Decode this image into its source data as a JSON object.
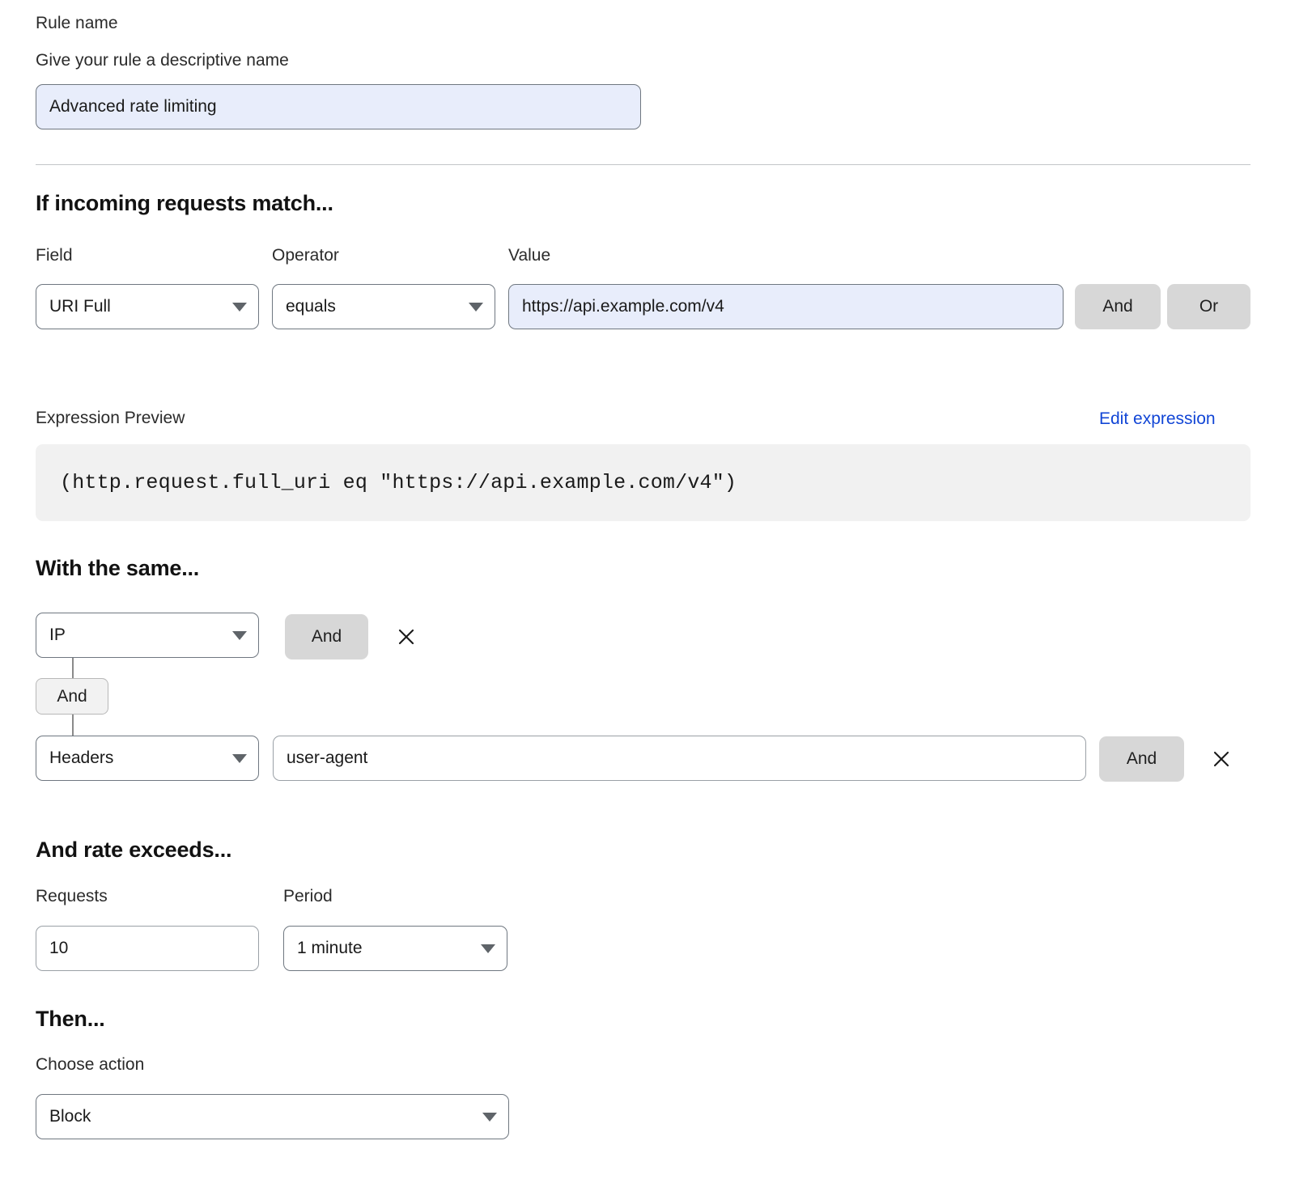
{
  "rule_name": {
    "title": "Rule name",
    "help": "Give your rule a descriptive name",
    "value": "Advanced rate limiting",
    "placeholder": "Rule name"
  },
  "match_section": {
    "heading": "If incoming requests match...",
    "field_label": "Field",
    "operator_label": "Operator",
    "value_label": "Value",
    "field_value": "URI Full",
    "operator_value": "equals",
    "value_value": "https://api.example.com/v4",
    "value_placeholder": "Enter value",
    "and_button": "And",
    "or_button": "Or"
  },
  "expression": {
    "label": "Expression Preview",
    "edit_link": "Edit expression",
    "code": "(http.request.full_uri eq \"https://api.example.com/v4\")"
  },
  "characteristics": {
    "heading": "With the same...",
    "rows": [
      {
        "select_value": "IP",
        "and_button": "And",
        "remove_icon": "close-icon"
      },
      {
        "select_value": "Headers",
        "text_value": "user-agent",
        "text_placeholder": "Header name",
        "and_button": "And",
        "remove_icon": "close-icon"
      }
    ],
    "connector_label": "And"
  },
  "rate": {
    "heading": "And rate exceeds...",
    "requests_label": "Requests",
    "period_label": "Period",
    "requests_value": "10",
    "period_value": "1 minute"
  },
  "then": {
    "heading": "Then...",
    "action_label": "Choose action",
    "action_value": "Block"
  },
  "colors": {
    "accent_link": "#1246d6",
    "input_filled": "#e8edfb",
    "gray_button": "#d7d7d7",
    "expression_bg": "#f1f1f1"
  }
}
